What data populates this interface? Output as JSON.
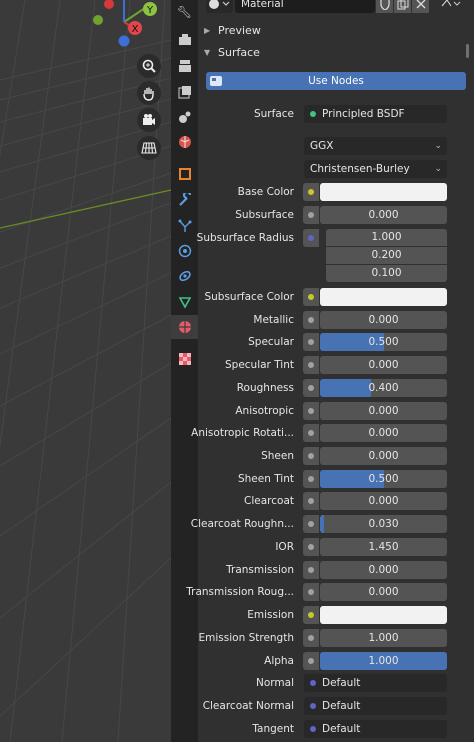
{
  "header": {
    "material_name": "Material"
  },
  "sections": {
    "preview": "Preview",
    "surface": "Surface"
  },
  "use_nodes": "Use Nodes",
  "surface_label": "Surface",
  "surface_shader": "Principled BSDF",
  "distribution": "GGX",
  "subsurface_method": "Christensen-Burley",
  "colors": {
    "accent": "#4772b3",
    "socket_color": "#c7c729",
    "socket_float": "#a1a1a1",
    "socket_vector": "#6363c7",
    "panel": "#303030",
    "field": "#545454",
    "base_color": "#f2f2f2",
    "subsurface_color": "#f2f2f2",
    "emission_color": "#000000"
  },
  "labels": {
    "base_color": "Base Color",
    "subsurface": "Subsurface",
    "subsurface_radius": "Subsurface Radius",
    "subsurface_color": "Subsurface Color",
    "metallic": "Metallic",
    "specular": "Specular",
    "specular_tint": "Specular Tint",
    "roughness": "Roughness",
    "anisotropic": "Anisotropic",
    "anisotropic_rotation": "Anisotropic Rotati...",
    "sheen": "Sheen",
    "sheen_tint": "Sheen Tint",
    "clearcoat": "Clearcoat",
    "clearcoat_roughness": "Clearcoat Roughn...",
    "ior": "IOR",
    "transmission": "Transmission",
    "transmission_roughness": "Transmission Roug...",
    "emission": "Emission",
    "emission_strength": "Emission Strength",
    "alpha": "Alpha",
    "normal": "Normal",
    "clearcoat_normal": "Clearcoat Normal",
    "tangent": "Tangent"
  },
  "values": {
    "subsurface": "0.000",
    "subsurface_radius": [
      "1.000",
      "0.200",
      "0.100"
    ],
    "metallic": "0.000",
    "specular": "0.500",
    "specular_tint": "0.000",
    "roughness": "0.400",
    "anisotropic": "0.000",
    "anisotropic_rotation": "0.000",
    "sheen": "0.000",
    "sheen_tint": "0.500",
    "clearcoat": "0.000",
    "clearcoat_roughness": "0.030",
    "ior": "1.450",
    "transmission": "0.000",
    "transmission_roughness": "0.000",
    "emission_strength": "1.000",
    "alpha": "1.000",
    "normal": "Default",
    "clearcoat_normal": "Default",
    "tangent": "Default"
  },
  "fill_fraction": {
    "subsurface": 0,
    "metallic": 0,
    "specular": 0.5,
    "specular_tint": 0,
    "roughness": 0.4,
    "anisotropic": 0,
    "anisotropic_rotation": 0,
    "sheen": 0,
    "sheen_tint": 0.5,
    "clearcoat": 0,
    "clearcoat_roughness": 0.03,
    "transmission": 0,
    "transmission_roughness": 0,
    "alpha": 1
  },
  "viewport": {
    "gizmo_axis_y": "Y",
    "gizmo_axis_x": "X"
  },
  "icons": {
    "viewport": [
      "zoom-icon",
      "hand-pan-icon",
      "camera-icon",
      "grid-icon"
    ],
    "tabs": [
      "tool-icon",
      "render-icon",
      "output-icon",
      "view-layer-icon",
      "scene-icon",
      "world-icon",
      "object-icon",
      "modifier-icon",
      "particles-icon",
      "physics-icon",
      "constraints-icon",
      "data-icon",
      "material-icon",
      "texture-icon"
    ]
  }
}
